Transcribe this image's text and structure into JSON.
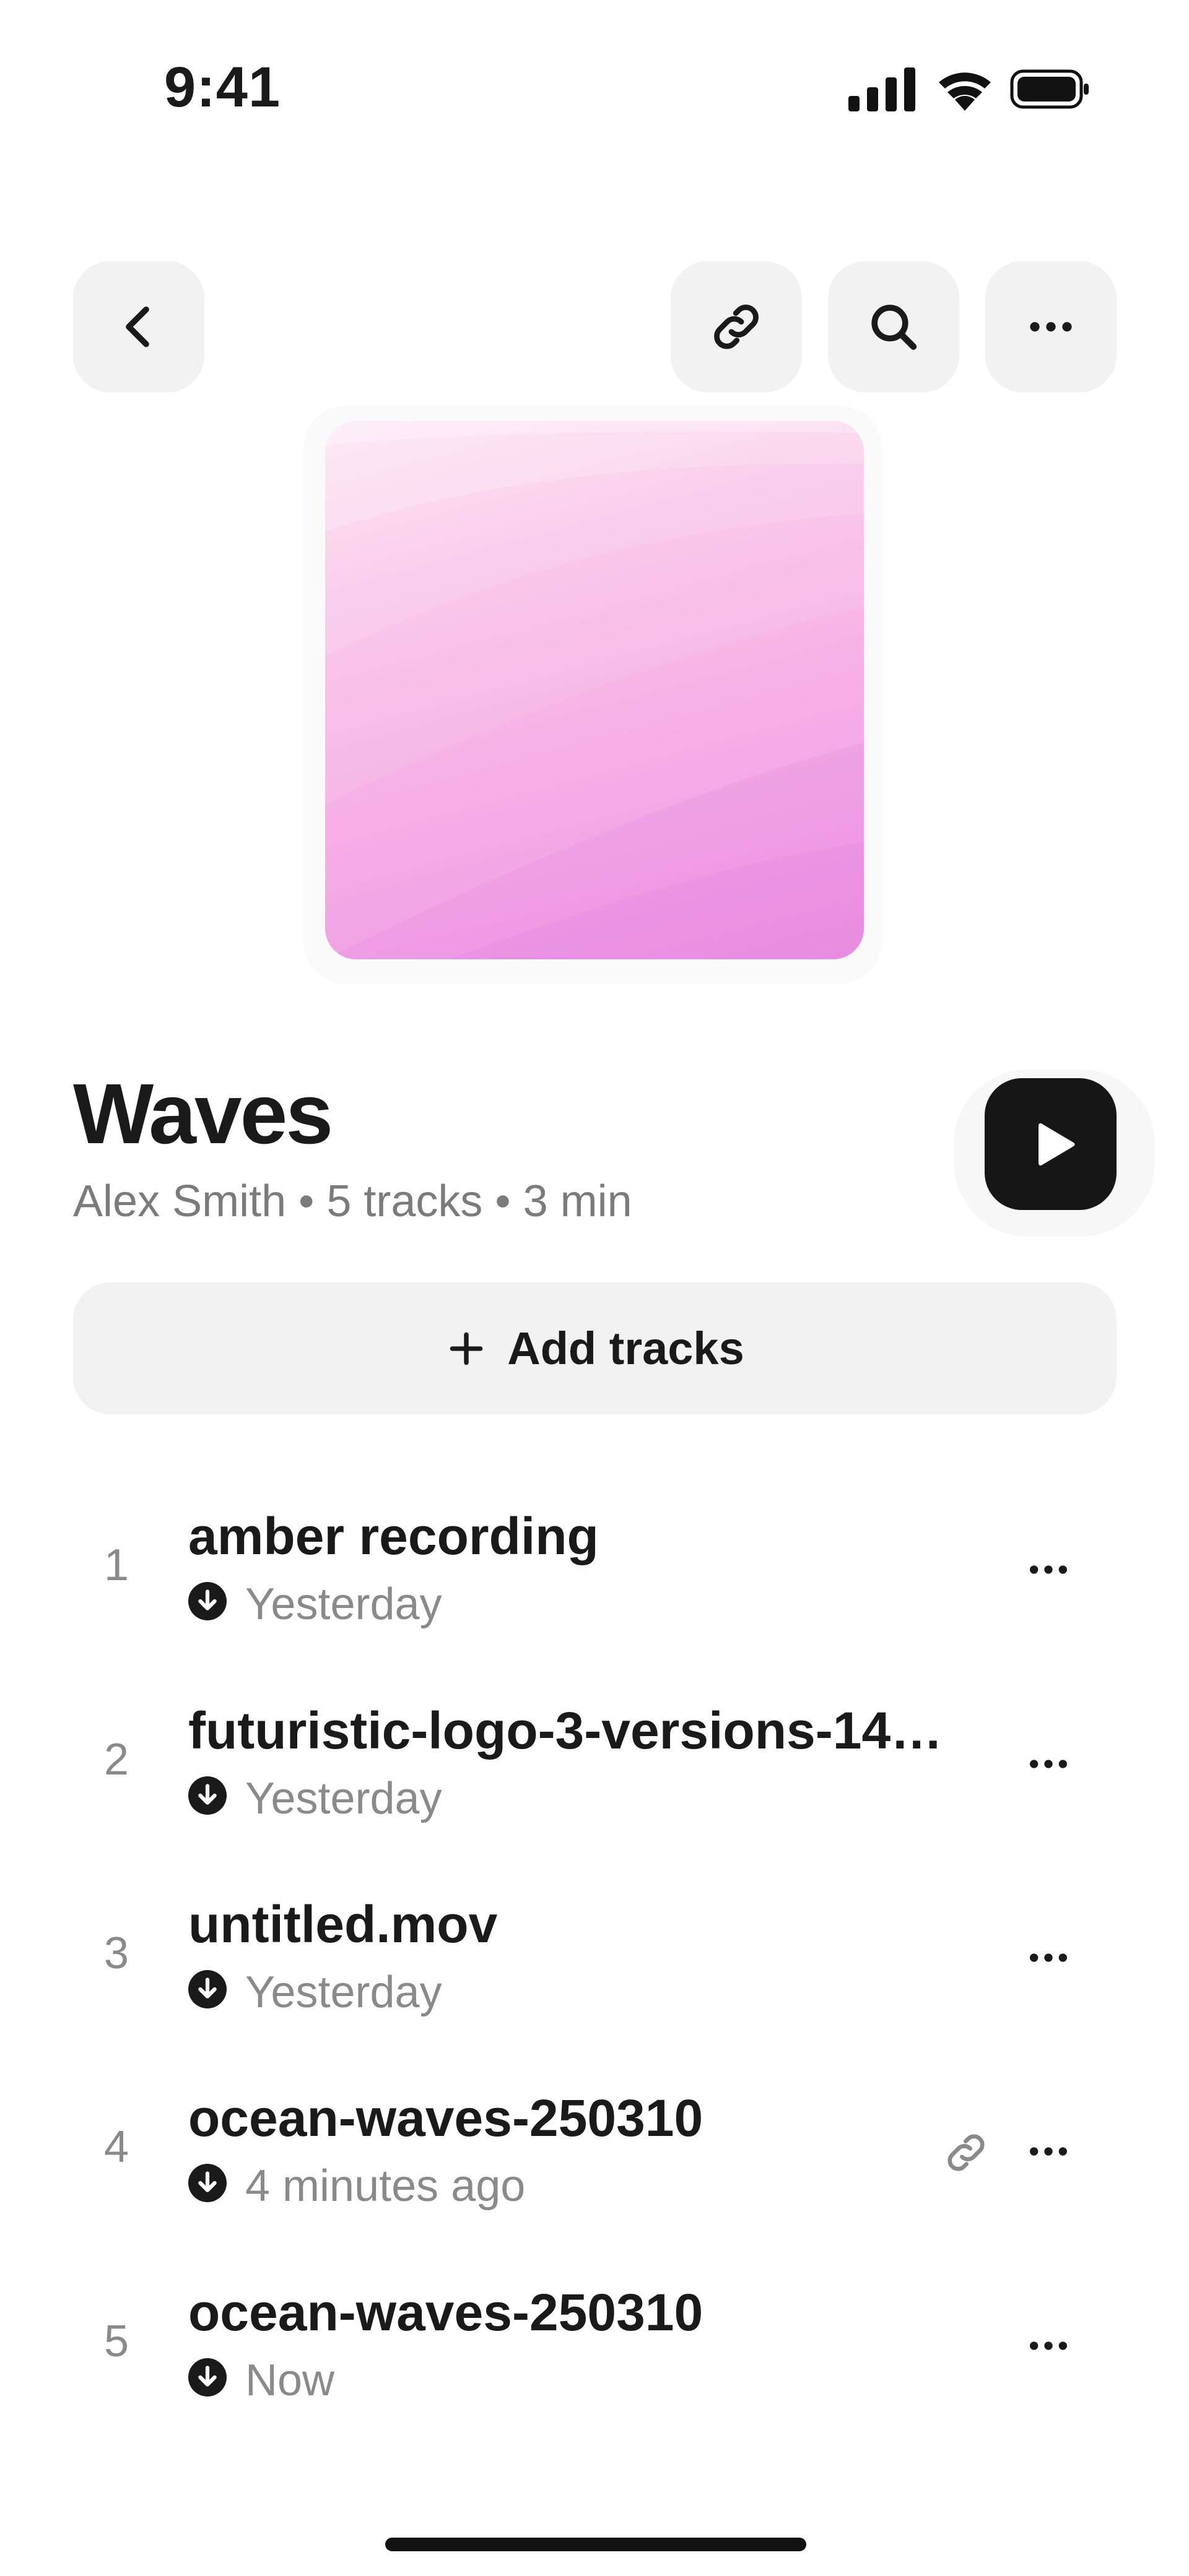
{
  "status_bar": {
    "time": "9:41"
  },
  "nav": {
    "back_icon": "chevron-left-icon",
    "link_icon": "link-icon",
    "search_icon": "search-icon",
    "more_icon": "more-horizontal-icon"
  },
  "playlist": {
    "title": "Waves",
    "meta": "Alex Smith • 5 tracks • 3 min",
    "artwork_colors": [
      "#fde2f2",
      "#f7b5e6",
      "#ed94e5"
    ]
  },
  "add_tracks": {
    "label": "Add tracks"
  },
  "tracks": [
    {
      "number": "1",
      "name": "amber recording",
      "time": "Yesterday",
      "shared": false
    },
    {
      "number": "2",
      "name": "futuristic-logo-3-versions-149…",
      "time": "Yesterday",
      "shared": false
    },
    {
      "number": "3",
      "name": "untitled.mov",
      "time": "Yesterday",
      "shared": false
    },
    {
      "number": "4",
      "name": "ocean-waves-250310",
      "time": "4 minutes ago",
      "shared": true
    },
    {
      "number": "5",
      "name": "ocean-waves-250310",
      "time": "Now",
      "shared": false
    }
  ],
  "colors": {
    "button_bg": "#f2f2f2",
    "play_bg": "#161616",
    "secondary_text": "#8a8a8a"
  }
}
